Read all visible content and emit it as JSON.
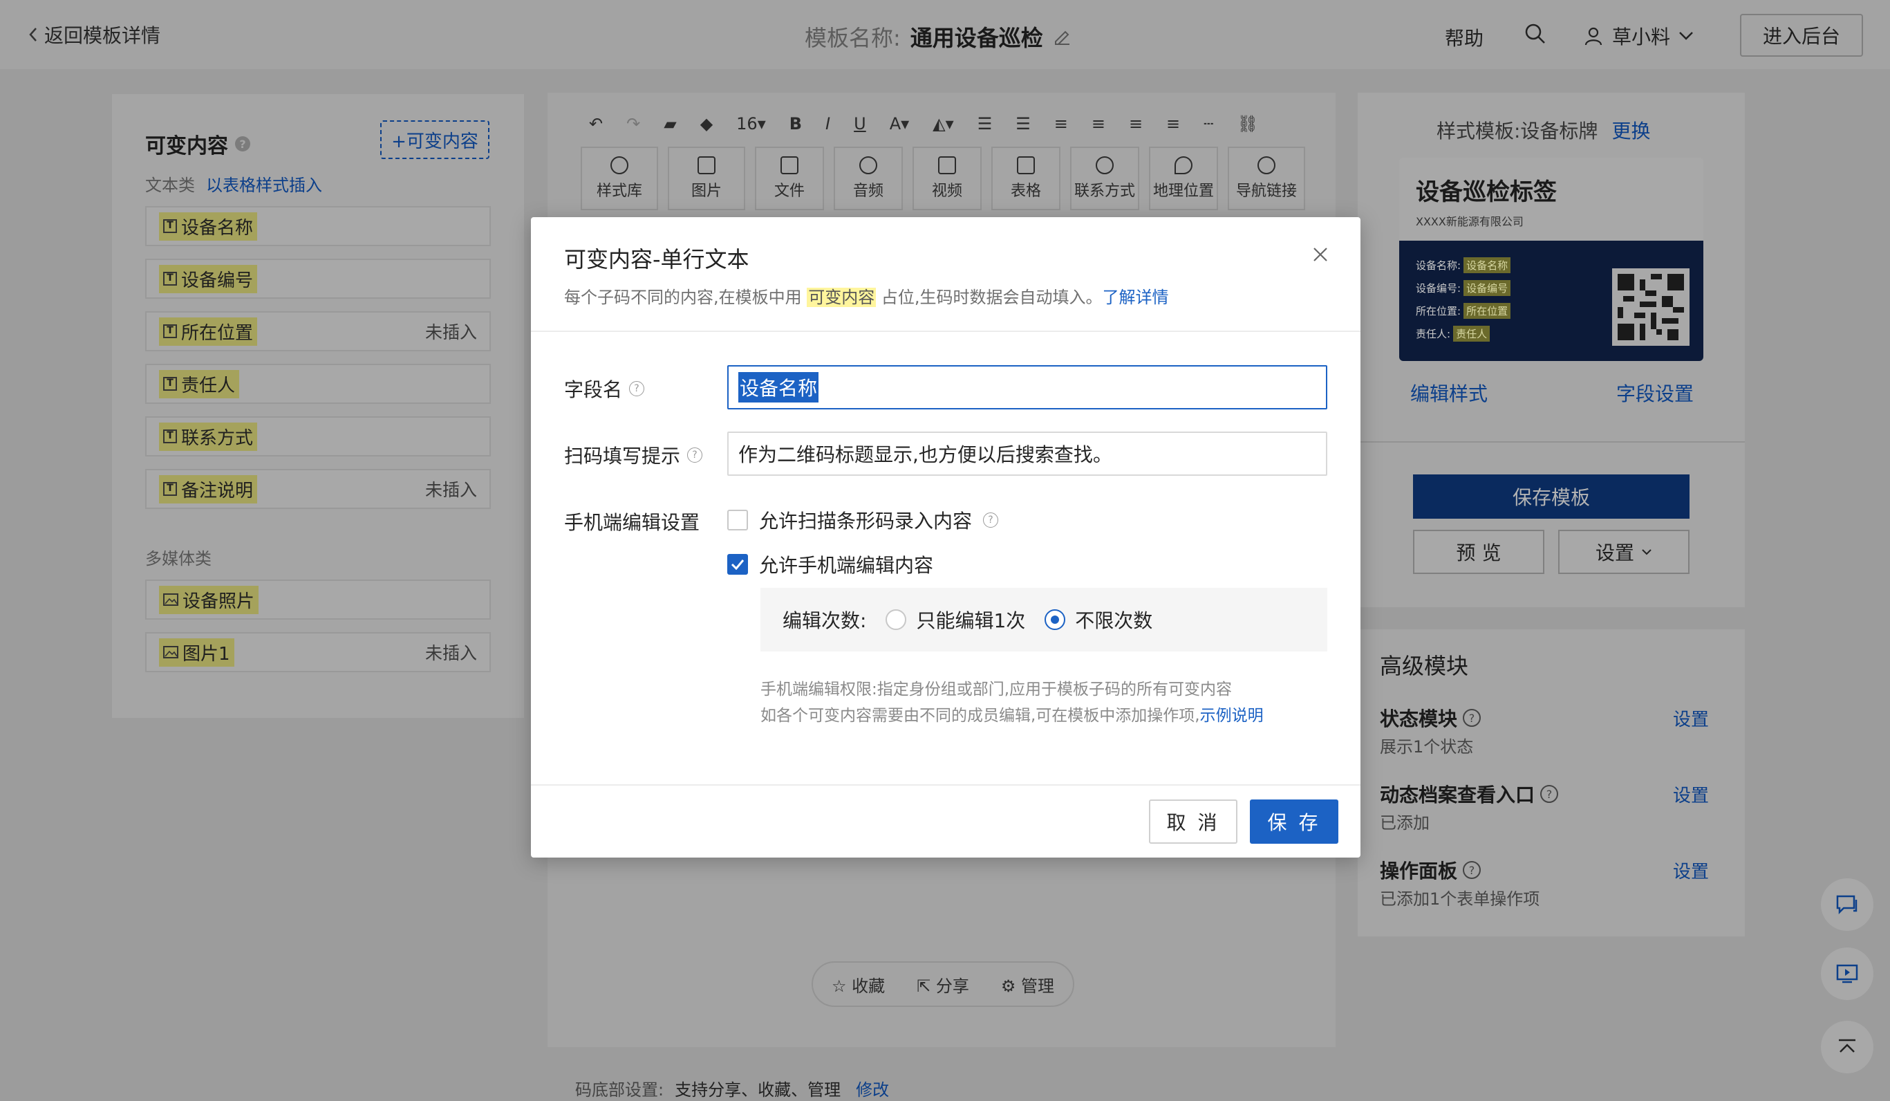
{
  "header": {
    "back_label": "返回模板详情",
    "template_label": "模板名称:",
    "template_name": "通用设备巡检",
    "help": "帮助",
    "user_name": "草小料",
    "admin_button": "进入后台"
  },
  "left_panel": {
    "title": "可变内容",
    "add_button": "+可变内容",
    "text_group_label": "文本类",
    "text_group_link": "以表格样式插入",
    "text_items": [
      {
        "label": "设备名称",
        "note": ""
      },
      {
        "label": "设备编号",
        "note": ""
      },
      {
        "label": "所在位置",
        "note": "未插入"
      },
      {
        "label": "责任人",
        "note": ""
      },
      {
        "label": "联系方式",
        "note": ""
      },
      {
        "label": "备注说明",
        "note": "未插入"
      }
    ],
    "media_group_label": "多媒体类",
    "media_items": [
      {
        "label": "设备照片",
        "note": ""
      },
      {
        "label": "图片1",
        "note": "未插入"
      }
    ]
  },
  "editor": {
    "font_size": "16",
    "tools": [
      "样式库",
      "图片",
      "文件",
      "音频",
      "视频",
      "表格",
      "联系方式",
      "地理位置",
      "导航链接"
    ],
    "share_bar": {
      "collect": "收藏",
      "share": "分享",
      "manage": "管理"
    },
    "footer_label": "码底部设置:",
    "footer_value": "支持分享、收藏、管理",
    "footer_link": "修改"
  },
  "right_panel": {
    "style_label": "样式模板:设备标牌",
    "style_link": "更换",
    "card": {
      "title": "设备巡检标签",
      "company": "XXXX新能源有限公司",
      "rows": [
        {
          "k": "设备名称:",
          "v": "设备名称"
        },
        {
          "k": "设备编号:",
          "v": "设备编号"
        },
        {
          "k": "所在位置:",
          "v": "所在位置"
        },
        {
          "k": "责任人:",
          "v": "责任人"
        }
      ]
    },
    "edit_style": "编辑样式",
    "field_settings": "字段设置",
    "save_template": "保存模板",
    "preview": "预 览",
    "settings": "设置",
    "advanced_title": "高级模块",
    "modules": [
      {
        "name": "状态模块",
        "desc": "展示1个状态",
        "action": "设置"
      },
      {
        "name": "动态档案查看入口",
        "desc": "已添加",
        "action": "设置"
      },
      {
        "name": "操作面板",
        "desc": "已添加1个表单操作项",
        "action": "设置"
      }
    ]
  },
  "modal": {
    "title": "可变内容-单行文本",
    "desc_pre": "每个子码不同的内容,在模板中用",
    "desc_hl": "可变内容",
    "desc_post": "占位,生码时数据会自动填入。",
    "desc_link": "了解详情",
    "field_name_label": "字段名",
    "field_name_value": "设备名称",
    "hint_label": "扫码填写提示",
    "hint_value": "作为二维码标题显示,也方便以后搜索查找。",
    "mobile_label": "手机端编辑设置",
    "opt_barcode": "允许扫描条形码录入内容",
    "opt_mobile_edit": "允许手机端编辑内容",
    "edit_count_label": "编辑次数:",
    "edit_once": "只能编辑1次",
    "edit_unlimited": "不限次数",
    "perm_line1": "手机端编辑权限:指定身份组或部门,应用于模板子码的所有可变内容",
    "perm_line2": "如各个可变内容需要由不同的成员编辑,可在模板中添加操作项,",
    "perm_link": "示例说明",
    "cancel": "取 消",
    "save": "保 存"
  }
}
